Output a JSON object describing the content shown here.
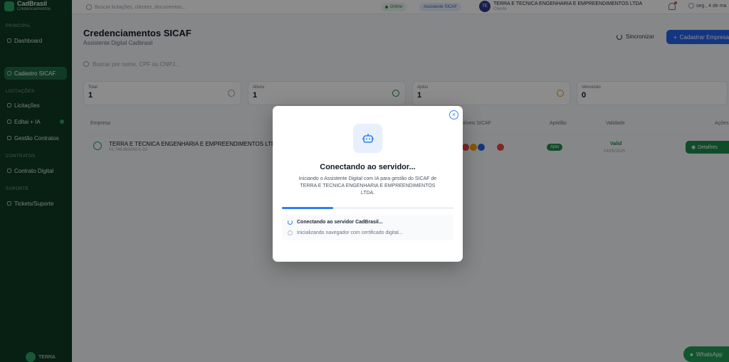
{
  "sidebar": {
    "brand_name": "CadBrasil",
    "brand_sub": "Credenciamentos",
    "sections": [
      {
        "label": "Principal",
        "items": [
          {
            "label": "Dashboard"
          }
        ]
      },
      {
        "label": "",
        "items": [
          {
            "label": "Cadastro SICAF",
            "active": true
          }
        ]
      },
      {
        "label": "Licitações",
        "items": [
          {
            "label": "Licitações"
          },
          {
            "label": "Editai + IA",
            "badge": true
          },
          {
            "label": "Gestão Contratos"
          }
        ]
      },
      {
        "label": "Contratos",
        "items": [
          {
            "label": "Contrato Digital"
          }
        ]
      },
      {
        "label": "Suporte",
        "items": [
          {
            "label": "Tickets/Suporte"
          }
        ]
      }
    ],
    "user_label": "TERRA"
  },
  "topbar": {
    "search_placeholder": "Buscar licitações, clientes, documentos...",
    "status_online": "Online",
    "status_sicaf": "Assistente SICAF",
    "company_initials": "TE",
    "company_name": "TERRA E TECNICA ENGENHARIA E EMPREENDIMENTOS LTDA",
    "company_sub": "Cliente",
    "date": "seg., 4 de ma"
  },
  "page": {
    "title": "Credenciamentos SICAF",
    "subtitle": "Assistente Digital Cadbrasil",
    "refresh_label": "Sincronizar",
    "primary_label": "Cadastrar Empresa",
    "search_placeholder": "Buscar por nome, CPF ou CNPJ..."
  },
  "cards": [
    {
      "label": "Total",
      "value": "1",
      "color": "#6b7280"
    },
    {
      "label": "Ativos",
      "value": "1",
      "color": "#1f8a4c"
    },
    {
      "label": "Aptos",
      "value": "1",
      "color": "#d4a017"
    },
    {
      "label": "Vencendo",
      "value": "0",
      "color": "#ef4444"
    }
  ],
  "table": {
    "headers": [
      "Empresa",
      "Níveis SICAF",
      "Aptidão",
      "Validade",
      "Ações"
    ],
    "row": {
      "name": "TERRA E TECNICA ENGENHARIA E EMPREENDIMENTOS LTDA",
      "cnpj": "01.748.885/0001-33",
      "status": "Apto",
      "validity_label": "Valid",
      "validity_date": "04/05/2025",
      "action": "Detalhes",
      "level_colors": [
        "#ef4444",
        "#f59e0b",
        "#2563eb",
        "#ef4444"
      ]
    }
  },
  "whatsapp_label": "WhatsApp",
  "modal": {
    "title": "Conectando ao servidor...",
    "description": "Iniciando o Assistente Digital com IA para gestão do SICAF de TERRA E TECNICA ENGENHARIA E EMPREENDIMENTOS LTDA.",
    "progress": 0.3,
    "steps": [
      {
        "label": "Conectando ao servidor CadBrasil...",
        "state": "active"
      },
      {
        "label": "Inicializando navegador com certificado digital...",
        "state": "pending"
      }
    ],
    "accent": "#2f80ed"
  }
}
